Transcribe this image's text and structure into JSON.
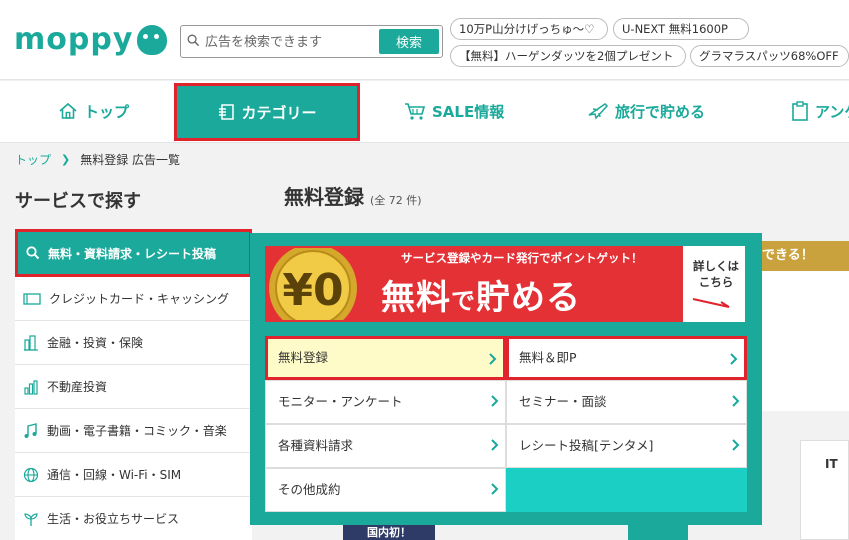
{
  "header": {
    "logo_text": "moppy",
    "search": {
      "placeholder": "広告を検索できます",
      "button": "検索"
    },
    "tags": [
      "10万P山分けげっちゅ〜♡",
      "U-NEXT 無料1600P",
      "【無料】ハーゲンダッツを2個プレゼント",
      "グラマラスパッツ68%OFF"
    ]
  },
  "nav": {
    "items": [
      {
        "label": "トップ",
        "icon": "house-icon"
      },
      {
        "label": "カテゴリー",
        "icon": "list-icon",
        "active": true
      },
      {
        "label": "SALE情報",
        "icon": "cart-icon"
      },
      {
        "label": "旅行で貯める",
        "icon": "airplane-icon"
      },
      {
        "label": "アンケ",
        "icon": "clipboard-icon"
      }
    ]
  },
  "breadcrumb": {
    "home": "トップ",
    "current": "無料登録 広告一覧"
  },
  "sidebar": {
    "title": "サービスで探す",
    "items": [
      {
        "label": "無料・資料請求・レシート投稿",
        "icon": "search-icon",
        "active": true
      },
      {
        "label": "クレジットカード・キャッシング",
        "icon": "card-icon"
      },
      {
        "label": "金融・投資・保険",
        "icon": "building-icon"
      },
      {
        "label": "不動産投資",
        "icon": "bar-chart-icon"
      },
      {
        "label": "動画・電子書籍・コミック・音楽",
        "icon": "music-note-icon"
      },
      {
        "label": "通信・回線・Wi-Fi・SIM",
        "icon": "globe-icon"
      },
      {
        "label": "生活・お役立ちサービス",
        "icon": "sprout-icon"
      }
    ]
  },
  "main": {
    "title": "無料登録",
    "count": "(全 72 件)",
    "bg_banner_text": "できる！",
    "bg_card_text": "IT",
    "bg_navy_text": "国内初！"
  },
  "dropdown": {
    "promo": {
      "coin_text": "¥0",
      "sub": "サービス登録やカード発行でポイントゲット！",
      "main_a": "無料",
      "main_b": "で",
      "main_c": "貯める",
      "right_text": "詳しくはこちら"
    },
    "cells": [
      {
        "label": "無料登録",
        "highlight": true,
        "boxed": true
      },
      {
        "label": "無料＆即P",
        "boxed": true
      },
      {
        "label": "モニター・アンケート"
      },
      {
        "label": "セミナー・面談"
      },
      {
        "label": "各種資料請求"
      },
      {
        "label": "レシート投稿[テンタメ]"
      },
      {
        "label": "その他成約"
      }
    ]
  },
  "colors": {
    "brand": "#1aa99a",
    "highlight_red": "#e0232d",
    "promo_red": "#e43136",
    "cell_highlight": "#fefbc8"
  }
}
